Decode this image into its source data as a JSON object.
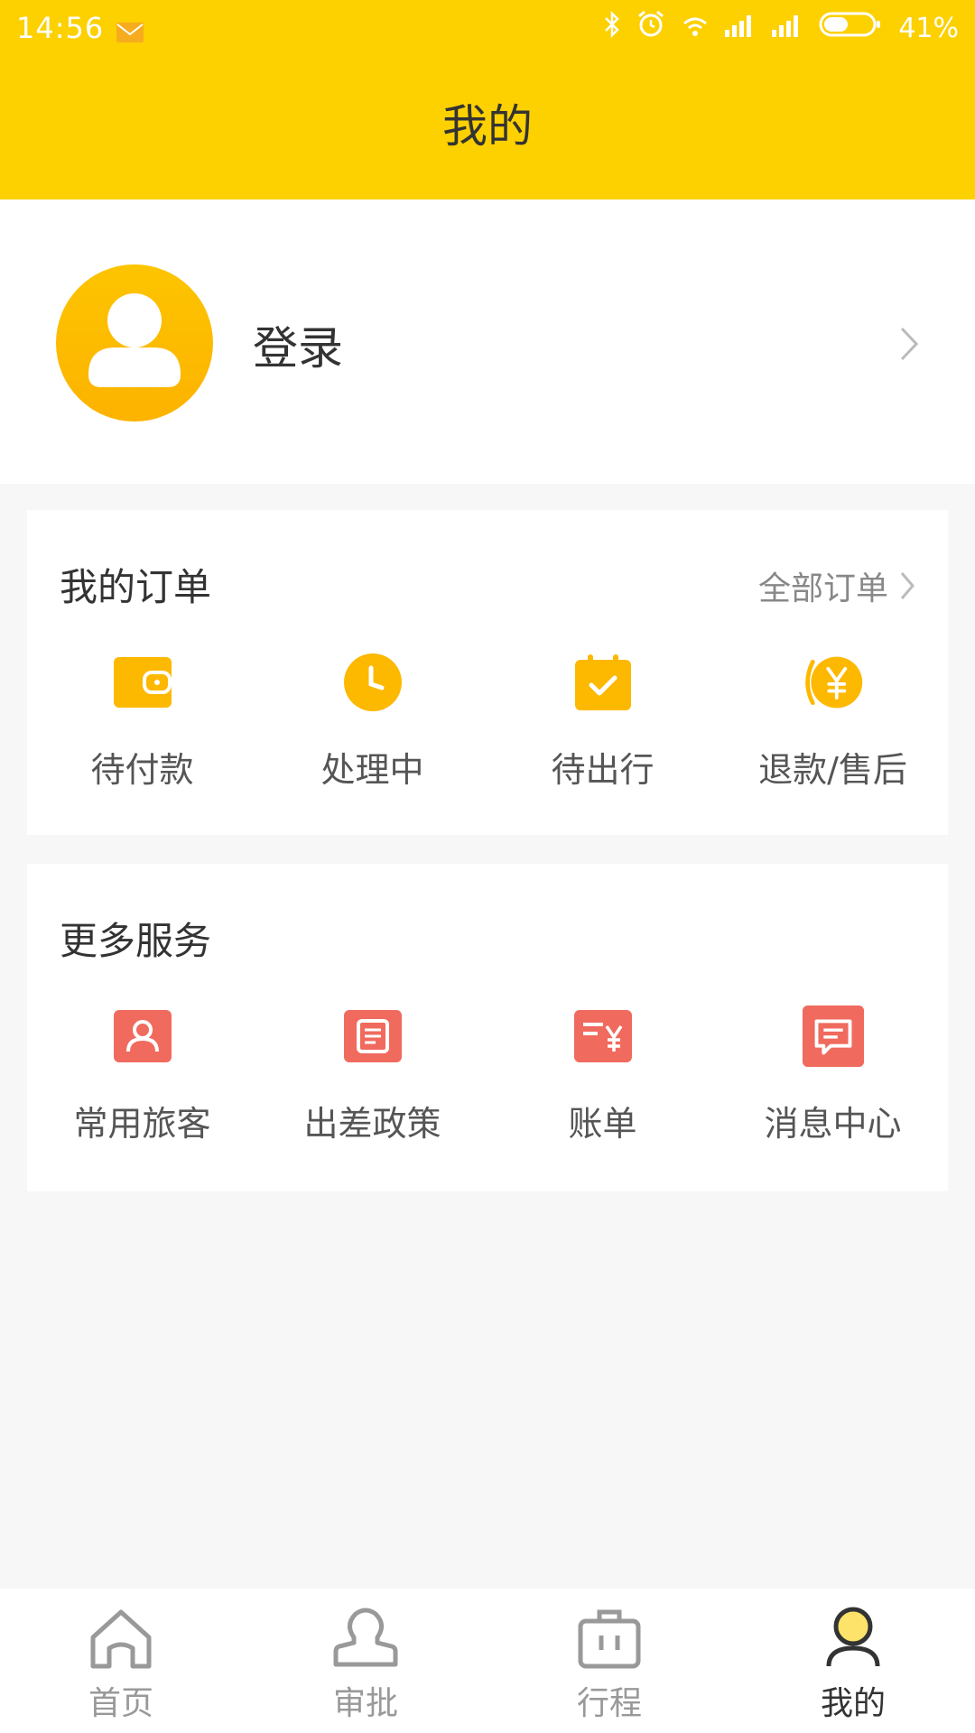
{
  "status": {
    "time": "14:56",
    "battery": "41%"
  },
  "header": {
    "title": "我的"
  },
  "profile": {
    "login_label": "登录"
  },
  "orders": {
    "title": "我的订单",
    "all_label": "全部订单",
    "items": [
      {
        "label": "待付款",
        "icon": "wallet-icon"
      },
      {
        "label": "处理中",
        "icon": "clock-icon"
      },
      {
        "label": "待出行",
        "icon": "calendar-check-icon"
      },
      {
        "label": "退款/售后",
        "icon": "refund-icon"
      }
    ]
  },
  "services": {
    "title": "更多服务",
    "items": [
      {
        "label": "常用旅客",
        "icon": "traveler-icon"
      },
      {
        "label": "出差政策",
        "icon": "policy-icon"
      },
      {
        "label": "账单",
        "icon": "bill-icon"
      },
      {
        "label": "消息中心",
        "icon": "message-icon"
      }
    ]
  },
  "tabbar": {
    "items": [
      {
        "label": "首页",
        "icon": "home-icon"
      },
      {
        "label": "审批",
        "icon": "approval-icon"
      },
      {
        "label": "行程",
        "icon": "briefcase-icon"
      },
      {
        "label": "我的",
        "icon": "profile-icon",
        "active": true
      }
    ]
  },
  "colors": {
    "accent": "#fdd000",
    "order_icon": "#fdb800",
    "service_icon": "#f06a5e"
  }
}
